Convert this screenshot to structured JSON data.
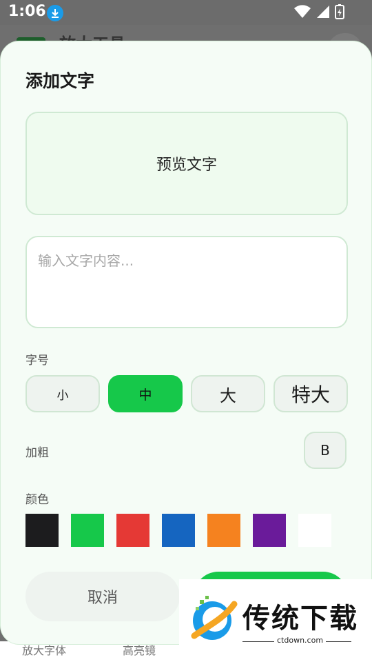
{
  "status_bar": {
    "time": "1:06"
  },
  "background_app": {
    "title": "放大工具",
    "bottom_items": [
      "放大字体",
      "高亮镜"
    ]
  },
  "dialog": {
    "title": "添加文字",
    "preview_text": "预览文字",
    "input": {
      "value": "",
      "placeholder": "输入文字内容..."
    },
    "size_label": "字号",
    "sizes": [
      {
        "label": "小",
        "selected": false
      },
      {
        "label": "中",
        "selected": true
      },
      {
        "label": "大",
        "selected": false
      },
      {
        "label": "特大",
        "selected": false
      }
    ],
    "bold_label": "加粗",
    "bold_button": "B",
    "color_label": "颜色",
    "colors": [
      "#1c1c1e",
      "#16c84a",
      "#e53935",
      "#1565c0",
      "#f5821f",
      "#6a1b9a",
      "#ffffff"
    ],
    "cancel_label": "取消"
  },
  "watermark": {
    "brand": "传统下载",
    "url": "ctdown.com"
  }
}
